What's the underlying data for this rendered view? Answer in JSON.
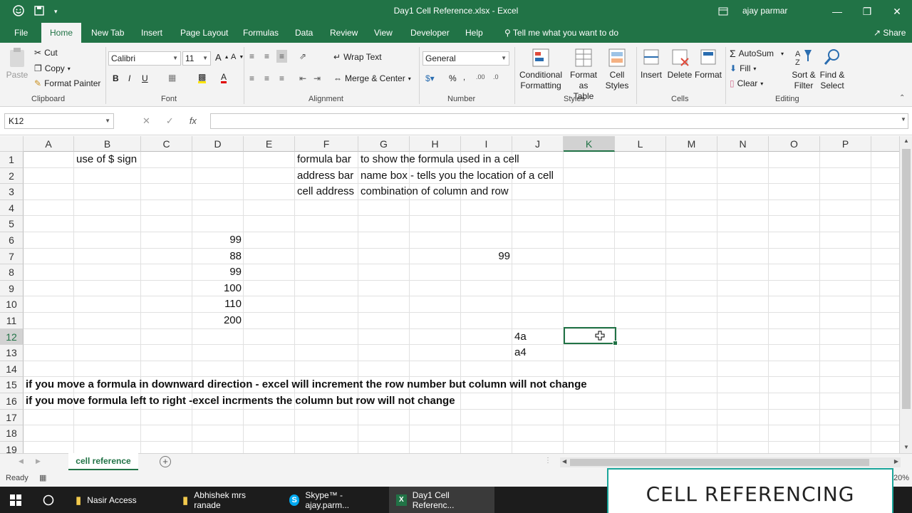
{
  "window": {
    "title": "Day1 Cell Reference.xlsx  -  Excel",
    "user": "ajay parmar"
  },
  "menu": {
    "tabs": [
      "File",
      "Home",
      "New Tab",
      "Insert",
      "Page Layout",
      "Formulas",
      "Data",
      "Review",
      "View",
      "Developer",
      "Help"
    ],
    "tell_me": "Tell me what you want to do",
    "share": "Share"
  },
  "ribbon": {
    "clipboard": {
      "paste": "Paste",
      "cut": "Cut",
      "copy": "Copy",
      "format_painter": "Format Painter",
      "label": "Clipboard"
    },
    "font": {
      "name": "Calibri",
      "size": "11",
      "label": "Font"
    },
    "alignment": {
      "wrap_text": "Wrap Text",
      "merge_center": "Merge & Center",
      "label": "Alignment"
    },
    "number": {
      "format": "General",
      "label": "Number"
    },
    "styles": {
      "conditional": "Conditional",
      "conditional2": "Formatting",
      "format_as": "Format as",
      "format_as2": "Table",
      "cell": "Cell",
      "cell2": "Styles",
      "label": "Styles"
    },
    "cells": {
      "insert": "Insert",
      "delete": "Delete",
      "format": "Format",
      "label": "Cells"
    },
    "editing": {
      "autosum": "AutoSum",
      "fill": "Fill",
      "clear": "Clear",
      "sort": "Sort &",
      "sort2": "Filter",
      "find": "Find &",
      "find2": "Select",
      "label": "Editing"
    }
  },
  "formula_bar": {
    "name_box": "K12",
    "formula": ""
  },
  "sheet": {
    "columns": [
      "A",
      "B",
      "C",
      "D",
      "E",
      "F",
      "G",
      "H",
      "I",
      "J",
      "K",
      "L",
      "M",
      "N",
      "O",
      "P"
    ],
    "rows": [
      "1",
      "2",
      "3",
      "4",
      "5",
      "6",
      "7",
      "8",
      "9",
      "10",
      "11",
      "12",
      "13",
      "14",
      "15",
      "16",
      "17",
      "18",
      "19"
    ],
    "selected_column": "K",
    "selected_row": "12",
    "cells": {
      "B1": "use of $ sign",
      "F1": "formula bar",
      "G1": "to show the formula used in a cell",
      "F2": "address bar",
      "G2": "name box - tells you the location of a cell",
      "F3": "cell address",
      "G3": "combination of column and row",
      "D6": "99",
      "D7": "88",
      "I7": "99",
      "D8": "99",
      "D9": "100",
      "D10": "110",
      "D11": "200",
      "J12": "4a",
      "J13": "a4",
      "A15": "if you move a formula in downward direction - excel will increment the row number but column will not change",
      "A16": "if you move formula left to right -excel incrments the column but row will not change"
    }
  },
  "sheet_tabs": {
    "active": "cell reference"
  },
  "status": {
    "ready": "Ready",
    "zoom": "20%"
  },
  "taskbar": {
    "items": [
      "Nasir Access",
      "Abhishek mrs ranade",
      "Skype™ - ajay.parm...",
      "Day1 Cell Referenc..."
    ]
  },
  "banner": {
    "text": "CELL REFERENCING"
  },
  "colors": {
    "accent": "#217346",
    "banner_border": "#1aa59a"
  }
}
